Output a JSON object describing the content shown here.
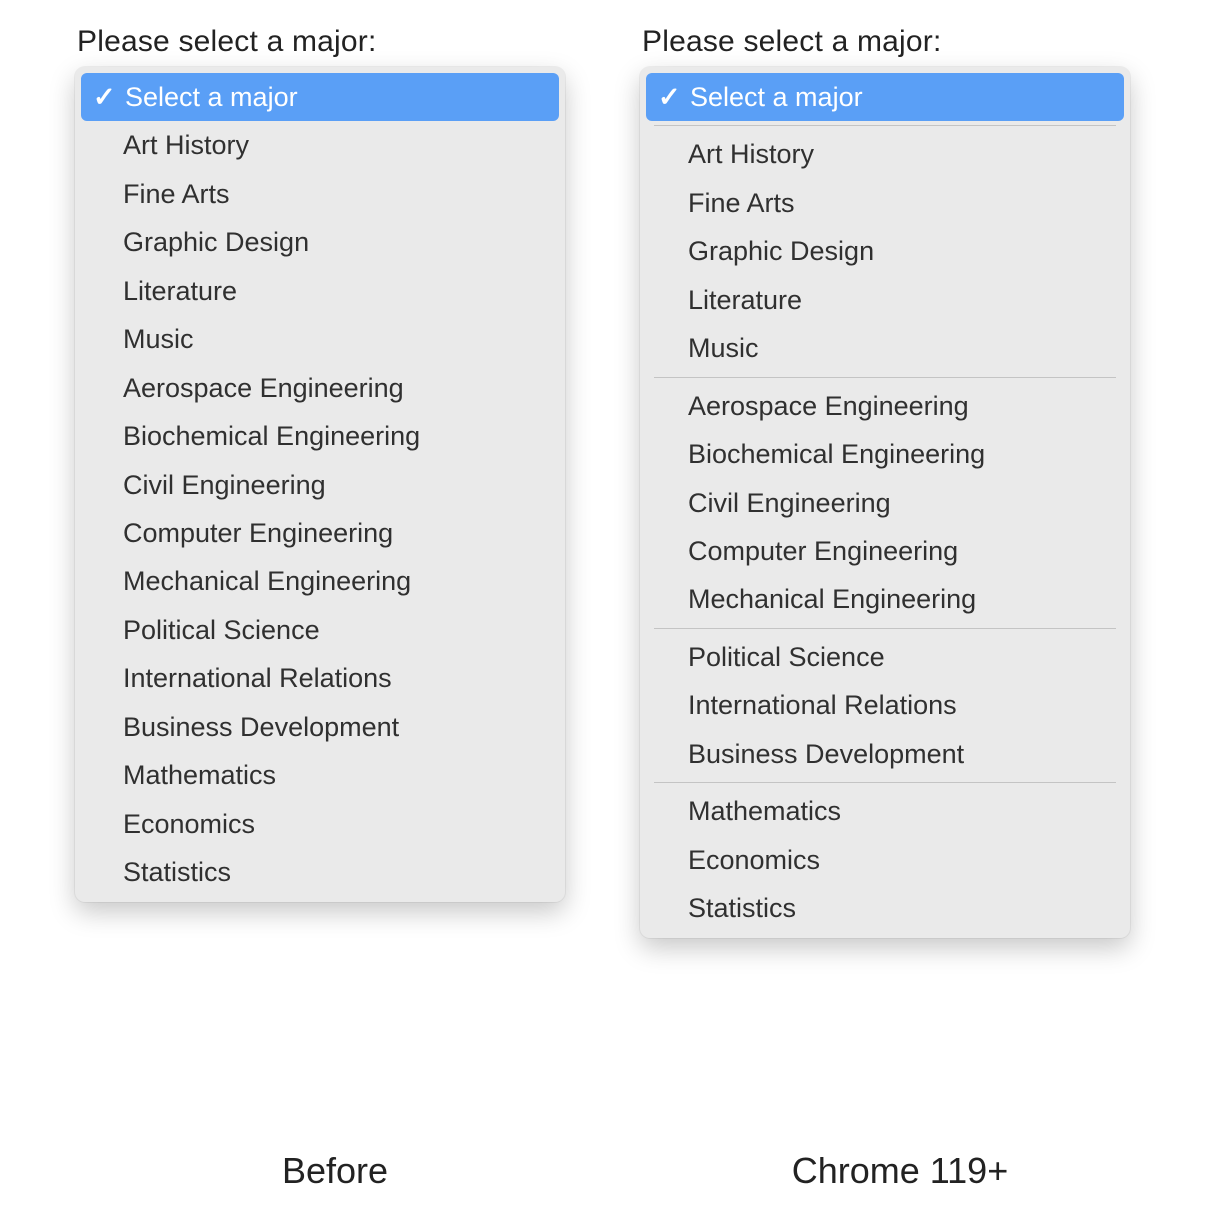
{
  "left": {
    "prompt": "Please select a major:",
    "caption": "Before",
    "selected_label": "Select a major",
    "items": [
      "Art History",
      "Fine Arts",
      "Graphic Design",
      "Literature",
      "Music",
      "Aerospace Engineering",
      "Biochemical Engineering",
      "Civil Engineering",
      "Computer Engineering",
      "Mechanical Engineering",
      "Political Science",
      "International Relations",
      "Business Development",
      "Mathematics",
      "Economics",
      "Statistics"
    ]
  },
  "right": {
    "prompt": "Please select a major:",
    "caption": "Chrome 119+",
    "selected_label": "Select a major",
    "groups": [
      [
        "Art History",
        "Fine Arts",
        "Graphic Design",
        "Literature",
        "Music"
      ],
      [
        "Aerospace Engineering",
        "Biochemical Engineering",
        "Civil Engineering",
        "Computer Engineering",
        "Mechanical Engineering"
      ],
      [
        "Political Science",
        "International Relations",
        "Business Development"
      ],
      [
        "Mathematics",
        "Economics",
        "Statistics"
      ]
    ]
  },
  "colors": {
    "highlight": "#5a9ff6",
    "panel": "#eaeaea",
    "divider": "#c4c4c4"
  }
}
